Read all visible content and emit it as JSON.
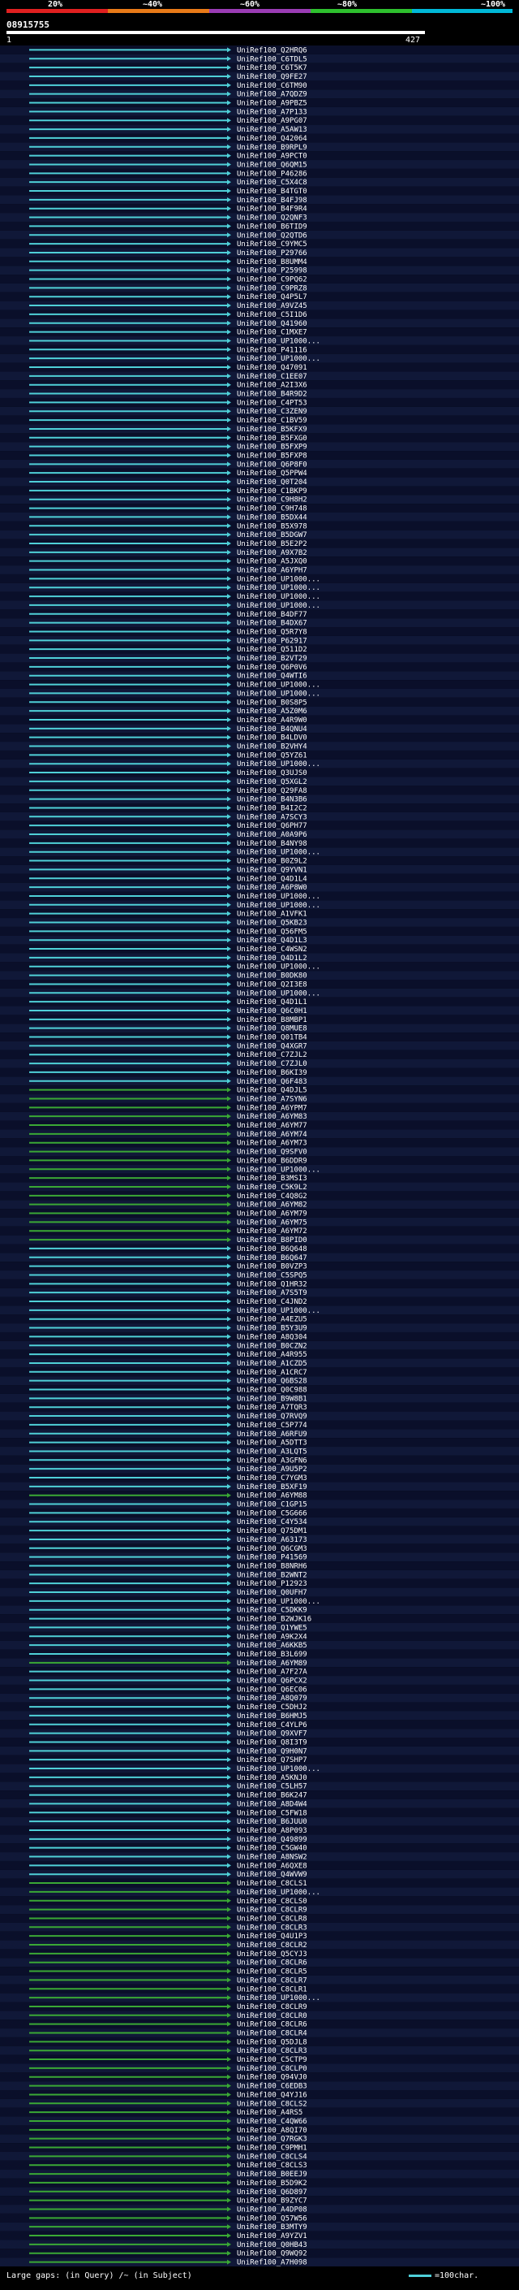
{
  "legend": {
    "percent_marks": [
      "20%",
      "~40%",
      "~60%",
      "~80%",
      "~100%"
    ],
    "band_colors": [
      "#e02020",
      "#e87a18",
      "#9a3cb4",
      "#2ec02e",
      "#00b8d8"
    ]
  },
  "query": {
    "id": "08915755",
    "length_start": "1",
    "length_end": "427"
  },
  "colors": {
    "cyan_hit": "#4fd0d8",
    "green_hit": "#3aa835",
    "row_bg_dark": "#0a0f2a",
    "row_bg_light": "#101838",
    "label": "#ffffff"
  },
  "hits": [
    {
      "label": "UniRef100_Q2HRQ6",
      "color": "cyan"
    },
    {
      "label": "UniRef100_C6TDL5",
      "color": "cyan"
    },
    {
      "label": "UniRef100_C6T5K7",
      "color": "cyan"
    },
    {
      "label": "UniRef100_Q9FE27",
      "color": "cyan"
    },
    {
      "label": "UniRef100_C6TM90",
      "color": "cyan"
    },
    {
      "label": "UniRef100_A7QDZ9",
      "color": "cyan"
    },
    {
      "label": "UniRef100_A9PBZ5",
      "color": "cyan"
    },
    {
      "label": "UniRef100_A7P133",
      "color": "cyan"
    },
    {
      "label": "UniRef100_A9PG07",
      "color": "cyan"
    },
    {
      "label": "UniRef100_A5AW13",
      "color": "cyan"
    },
    {
      "label": "UniRef100_Q42064",
      "color": "cyan"
    },
    {
      "label": "UniRef100_B9RPL9",
      "color": "cyan"
    },
    {
      "label": "UniRef100_A9PCT0",
      "color": "cyan"
    },
    {
      "label": "UniRef100_Q6QM15",
      "color": "cyan"
    },
    {
      "label": "UniRef100_P46286",
      "color": "cyan"
    },
    {
      "label": "UniRef100_C5X4C8",
      "color": "cyan"
    },
    {
      "label": "UniRef100_B4TGT0",
      "color": "cyan"
    },
    {
      "label": "UniRef100_B4FJ98",
      "color": "cyan"
    },
    {
      "label": "UniRef100_B4F9R4",
      "color": "cyan"
    },
    {
      "label": "UniRef100_Q2QNF3",
      "color": "cyan"
    },
    {
      "label": "UniRef100_B6TID9",
      "color": "cyan"
    },
    {
      "label": "UniRef100_Q2QTD6",
      "color": "cyan"
    },
    {
      "label": "UniRef100_C9YMC5",
      "color": "cyan"
    },
    {
      "label": "UniRef100_P29766",
      "color": "cyan"
    },
    {
      "label": "UniRef100_B8UMM4",
      "color": "cyan"
    },
    {
      "label": "UniRef100_P25998",
      "color": "cyan"
    },
    {
      "label": "UniRef100_C9PQ62",
      "color": "cyan"
    },
    {
      "label": "UniRef100_C9PRZ8",
      "color": "cyan"
    },
    {
      "label": "UniRef100_Q4P5L7",
      "color": "cyan"
    },
    {
      "label": "UniRef100_A9VZ45",
      "color": "cyan"
    },
    {
      "label": "UniRef100_C5I1D6",
      "color": "cyan"
    },
    {
      "label": "UniRef100_Q41960",
      "color": "cyan"
    },
    {
      "label": "UniRef100_C1MXE7",
      "color": "cyan"
    },
    {
      "label": "UniRef100_UP1000...",
      "color": "cyan"
    },
    {
      "label": "UniRef100_P41116",
      "color": "cyan"
    },
    {
      "label": "UniRef100_UP1000...",
      "color": "cyan"
    },
    {
      "label": "UniRef100_Q47091",
      "color": "cyan"
    },
    {
      "label": "UniRef100_C1EE07",
      "color": "cyan"
    },
    {
      "label": "UniRef100_A2I3X6",
      "color": "cyan"
    },
    {
      "label": "UniRef100_B4R9D2",
      "color": "cyan"
    },
    {
      "label": "UniRef100_C4PT53",
      "color": "cyan"
    },
    {
      "label": "UniRef100_C3ZEN9",
      "color": "cyan"
    },
    {
      "label": "UniRef100_C1BV59",
      "color": "cyan"
    },
    {
      "label": "UniRef100_B5KFX9",
      "color": "cyan"
    },
    {
      "label": "UniRef100_B5FXG0",
      "color": "cyan"
    },
    {
      "label": "UniRef100_B5FXP9",
      "color": "cyan"
    },
    {
      "label": "UniRef100_B5FXP8",
      "color": "cyan"
    },
    {
      "label": "UniRef100_Q6P8F0",
      "color": "cyan"
    },
    {
      "label": "UniRef100_Q5PPW4",
      "color": "cyan"
    },
    {
      "label": "UniRef100_Q0T204",
      "color": "cyan"
    },
    {
      "label": "UniRef100_C1BKP9",
      "color": "cyan"
    },
    {
      "label": "UniRef100_C9H8H2",
      "color": "cyan"
    },
    {
      "label": "UniRef100_C9H748",
      "color": "cyan"
    },
    {
      "label": "UniRef100_B5DX44",
      "color": "cyan"
    },
    {
      "label": "UniRef100_B5X978",
      "color": "cyan"
    },
    {
      "label": "UniRef100_B5DGW7",
      "color": "cyan"
    },
    {
      "label": "UniRef100_B5E2P2",
      "color": "cyan"
    },
    {
      "label": "UniRef100_A9X7B2",
      "color": "cyan"
    },
    {
      "label": "UniRef100_A5JXQ0",
      "color": "cyan"
    },
    {
      "label": "UniRef100_A6YPH7",
      "color": "cyan"
    },
    {
      "label": "UniRef100_UP1000...",
      "color": "cyan"
    },
    {
      "label": "UniRef100_UP1000...",
      "color": "cyan"
    },
    {
      "label": "UniRef100_UP1000...",
      "color": "cyan"
    },
    {
      "label": "UniRef100_UP1000...",
      "color": "cyan"
    },
    {
      "label": "UniRef100_B4DF77",
      "color": "cyan"
    },
    {
      "label": "UniRef100_B4DX67",
      "color": "cyan"
    },
    {
      "label": "UniRef100_Q5R7Y8",
      "color": "cyan"
    },
    {
      "label": "UniRef100_P62917",
      "color": "cyan"
    },
    {
      "label": "UniRef100_Q511D2",
      "color": "cyan"
    },
    {
      "label": "UniRef100_B2VT29",
      "color": "cyan"
    },
    {
      "label": "UniRef100_Q6P0V6",
      "color": "cyan"
    },
    {
      "label": "UniRef100_Q4WTI6",
      "color": "cyan"
    },
    {
      "label": "UniRef100_UP1000...",
      "color": "cyan"
    },
    {
      "label": "UniRef100_UP1000...",
      "color": "cyan"
    },
    {
      "label": "UniRef100_B0S8P5",
      "color": "cyan"
    },
    {
      "label": "UniRef100_A5Z0M6",
      "color": "cyan"
    },
    {
      "label": "UniRef100_A4R9W0",
      "color": "cyan"
    },
    {
      "label": "UniRef100_B4QNU4",
      "color": "cyan"
    },
    {
      "label": "UniRef100_B4LDV0",
      "color": "cyan"
    },
    {
      "label": "UniRef100_B2VHY4",
      "color": "cyan"
    },
    {
      "label": "UniRef100_Q5YZ61",
      "color": "cyan"
    },
    {
      "label": "UniRef100_UP1000...",
      "color": "cyan"
    },
    {
      "label": "UniRef100_Q3UJS0",
      "color": "cyan"
    },
    {
      "label": "UniRef100_Q5XGL2",
      "color": "cyan"
    },
    {
      "label": "UniRef100_Q29FA8",
      "color": "cyan"
    },
    {
      "label": "UniRef100_B4N3B6",
      "color": "cyan"
    },
    {
      "label": "UniRef100_B4I2C2",
      "color": "cyan"
    },
    {
      "label": "UniRef100_A7SCY3",
      "color": "cyan"
    },
    {
      "label": "UniRef100_Q6PH77",
      "color": "cyan"
    },
    {
      "label": "UniRef100_A0A9P6",
      "color": "cyan"
    },
    {
      "label": "UniRef100_B4NY98",
      "color": "cyan"
    },
    {
      "label": "UniRef100_UP1000...",
      "color": "cyan"
    },
    {
      "label": "UniRef100_B0Z9L2",
      "color": "cyan"
    },
    {
      "label": "UniRef100_Q9YVN1",
      "color": "cyan"
    },
    {
      "label": "UniRef100_Q4D1L4",
      "color": "cyan"
    },
    {
      "label": "UniRef100_A6P8W0",
      "color": "cyan"
    },
    {
      "label": "UniRef100_UP1000...",
      "color": "cyan"
    },
    {
      "label": "UniRef100_UP1000...",
      "color": "cyan"
    },
    {
      "label": "UniRef100_A1VFK1",
      "color": "cyan"
    },
    {
      "label": "UniRef100_Q5KB23",
      "color": "cyan"
    },
    {
      "label": "UniRef100_Q56FM5",
      "color": "cyan"
    },
    {
      "label": "UniRef100_Q4D1L3",
      "color": "cyan"
    },
    {
      "label": "UniRef100_C4WSN2",
      "color": "cyan"
    },
    {
      "label": "UniRef100_Q4D1L2",
      "color": "cyan"
    },
    {
      "label": "UniRef100_UP1000...",
      "color": "cyan"
    },
    {
      "label": "UniRef100_B0DK80",
      "color": "cyan"
    },
    {
      "label": "UniRef100_Q2I3E8",
      "color": "cyan"
    },
    {
      "label": "UniRef100_UP1000...",
      "color": "cyan"
    },
    {
      "label": "UniRef100_Q4D1L1",
      "color": "cyan"
    },
    {
      "label": "UniRef100_Q6C0H1",
      "color": "cyan"
    },
    {
      "label": "UniRef100_B8MBP1",
      "color": "cyan"
    },
    {
      "label": "UniRef100_Q8MUE8",
      "color": "cyan"
    },
    {
      "label": "UniRef100_Q01TB4",
      "color": "cyan"
    },
    {
      "label": "UniRef100_Q4XGR7",
      "color": "cyan"
    },
    {
      "label": "UniRef100_C7ZJL2",
      "color": "cyan"
    },
    {
      "label": "UniRef100_C7ZJL0",
      "color": "cyan"
    },
    {
      "label": "UniRef100_B6KI39",
      "color": "cyan"
    },
    {
      "label": "UniRef100_Q6F483",
      "color": "cyan"
    },
    {
      "label": "UniRef100_Q4DJL5",
      "color": "green"
    },
    {
      "label": "UniRef100_A7SYN6",
      "color": "green"
    },
    {
      "label": "UniRef100_A6YPM7",
      "color": "green"
    },
    {
      "label": "UniRef100_A6YM83",
      "color": "green"
    },
    {
      "label": "UniRef100_A6YM77",
      "color": "green"
    },
    {
      "label": "UniRef100_A6YM74",
      "color": "green"
    },
    {
      "label": "UniRef100_A6YM73",
      "color": "green"
    },
    {
      "label": "UniRef100_Q9SFV0",
      "color": "green"
    },
    {
      "label": "UniRef100_B6DDR9",
      "color": "green"
    },
    {
      "label": "UniRef100_UP1000...",
      "color": "green"
    },
    {
      "label": "UniRef100_B3MSI3",
      "color": "green"
    },
    {
      "label": "UniRef100_C5K9L2",
      "color": "green"
    },
    {
      "label": "UniRef100_C4Q8G2",
      "color": "green"
    },
    {
      "label": "UniRef100_A6YM82",
      "color": "green"
    },
    {
      "label": "UniRef100_A6YM79",
      "color": "green"
    },
    {
      "label": "UniRef100_A6YM75",
      "color": "green"
    },
    {
      "label": "UniRef100_A6YM72",
      "color": "green"
    },
    {
      "label": "UniRef100_B8PID0",
      "color": "green"
    },
    {
      "label": "UniRef100_B6Q648",
      "color": "cyan"
    },
    {
      "label": "UniRef100_B6Q647",
      "color": "cyan"
    },
    {
      "label": "UniRef100_B0VZP3",
      "color": "cyan"
    },
    {
      "label": "UniRef100_C5SPQ5",
      "color": "cyan"
    },
    {
      "label": "UniRef100_Q1HR32",
      "color": "cyan"
    },
    {
      "label": "UniRef100_A7S5T9",
      "color": "cyan"
    },
    {
      "label": "UniRef100_C4JND2",
      "color": "cyan"
    },
    {
      "label": "UniRef100_UP1000...",
      "color": "cyan"
    },
    {
      "label": "UniRef100_A4EZU5",
      "color": "cyan"
    },
    {
      "label": "UniRef100_B5Y3U9",
      "color": "cyan"
    },
    {
      "label": "UniRef100_A8Q304",
      "color": "cyan"
    },
    {
      "label": "UniRef100_B0CZN2",
      "color": "cyan"
    },
    {
      "label": "UniRef100_A4R955",
      "color": "cyan"
    },
    {
      "label": "UniRef100_A1CZD5",
      "color": "cyan"
    },
    {
      "label": "UniRef100_A1CRC7",
      "color": "cyan"
    },
    {
      "label": "UniRef100_Q6BS28",
      "color": "cyan"
    },
    {
      "label": "UniRef100_Q0C988",
      "color": "cyan"
    },
    {
      "label": "UniRef100_B9W8B1",
      "color": "cyan"
    },
    {
      "label": "UniRef100_A7TQR3",
      "color": "cyan"
    },
    {
      "label": "UniRef100_Q7RVQ9",
      "color": "cyan"
    },
    {
      "label": "UniRef100_C5P774",
      "color": "cyan"
    },
    {
      "label": "UniRef100_A6RFU9",
      "color": "cyan"
    },
    {
      "label": "UniRef100_A5DTT3",
      "color": "cyan"
    },
    {
      "label": "UniRef100_A3LQT5",
      "color": "cyan"
    },
    {
      "label": "UniRef100_A3GFN6",
      "color": "cyan"
    },
    {
      "label": "UniRef100_A9U5P2",
      "color": "cyan"
    },
    {
      "label": "UniRef100_C7YGM3",
      "color": "cyan"
    },
    {
      "label": "UniRef100_B5XF19",
      "color": "cyan"
    },
    {
      "label": "UniRef100_A6YM88",
      "color": "green"
    },
    {
      "label": "UniRef100_C1GP15",
      "color": "cyan"
    },
    {
      "label": "UniRef100_C5G666",
      "color": "cyan"
    },
    {
      "label": "UniRef100_C4Y534",
      "color": "cyan"
    },
    {
      "label": "UniRef100_Q75DM1",
      "color": "cyan"
    },
    {
      "label": "UniRef100_A63173",
      "color": "cyan"
    },
    {
      "label": "UniRef100_Q6CGM3",
      "color": "cyan"
    },
    {
      "label": "UniRef100_P41569",
      "color": "cyan"
    },
    {
      "label": "UniRef100_B8NRH6",
      "color": "cyan"
    },
    {
      "label": "UniRef100_B2WNT2",
      "color": "cyan"
    },
    {
      "label": "UniRef100_P12923",
      "color": "cyan"
    },
    {
      "label": "UniRef100_Q0UFH7",
      "color": "cyan"
    },
    {
      "label": "UniRef100_UP1000...",
      "color": "cyan"
    },
    {
      "label": "UniRef100_C5DKK9",
      "color": "cyan"
    },
    {
      "label": "UniRef100_B2WJK16",
      "color": "cyan"
    },
    {
      "label": "UniRef100_Q1YWE5",
      "color": "cyan"
    },
    {
      "label": "UniRef100_A9K2X4",
      "color": "cyan"
    },
    {
      "label": "UniRef100_A6KKB5",
      "color": "cyan"
    },
    {
      "label": "UniRef100_B3L699",
      "color": "cyan"
    },
    {
      "label": "UniRef100_A6YM89",
      "color": "green"
    },
    {
      "label": "UniRef100_A7F27A",
      "color": "cyan"
    },
    {
      "label": "UniRef100_Q6PCX2",
      "color": "cyan"
    },
    {
      "label": "UniRef100_Q6EC06",
      "color": "cyan"
    },
    {
      "label": "UniRef100_A8Q079",
      "color": "cyan"
    },
    {
      "label": "UniRef100_C5DHJ2",
      "color": "cyan"
    },
    {
      "label": "UniRef100_B6HMJ5",
      "color": "cyan"
    },
    {
      "label": "UniRef100_C4YLP6",
      "color": "cyan"
    },
    {
      "label": "UniRef100_Q9XVF7",
      "color": "cyan"
    },
    {
      "label": "UniRef100_Q8I3T9",
      "color": "cyan"
    },
    {
      "label": "UniRef100_Q9H0N7",
      "color": "cyan"
    },
    {
      "label": "UniRef100_Q7SHP7",
      "color": "cyan"
    },
    {
      "label": "UniRef100_UP1000...",
      "color": "cyan"
    },
    {
      "label": "UniRef100_A5KNJ0",
      "color": "cyan"
    },
    {
      "label": "UniRef100_C5LH57",
      "color": "cyan"
    },
    {
      "label": "UniRef100_B6K247",
      "color": "cyan"
    },
    {
      "label": "UniRef100_A8D4W4",
      "color": "cyan"
    },
    {
      "label": "UniRef100_C5FW18",
      "color": "cyan"
    },
    {
      "label": "UniRef100_B6JUU0",
      "color": "cyan"
    },
    {
      "label": "UniRef100_A8P093",
      "color": "cyan"
    },
    {
      "label": "UniRef100_Q49899",
      "color": "cyan"
    },
    {
      "label": "UniRef100_C5GW40",
      "color": "cyan"
    },
    {
      "label": "UniRef100_A8NSW2",
      "color": "cyan"
    },
    {
      "label": "UniRef100_A6QXE8",
      "color": "cyan"
    },
    {
      "label": "UniRef100_Q4WVW9",
      "color": "cyan"
    },
    {
      "label": "UniRef100_C8CLS1",
      "color": "green"
    },
    {
      "label": "UniRef100_UP1000...",
      "color": "green"
    },
    {
      "label": "UniRef100_C8CLS0",
      "color": "green"
    },
    {
      "label": "UniRef100_C8CLR9",
      "color": "green"
    },
    {
      "label": "UniRef100_C8CLR8",
      "color": "green"
    },
    {
      "label": "UniRef100_C8CLR3",
      "color": "green"
    },
    {
      "label": "UniRef100_Q4U1P3",
      "color": "green"
    },
    {
      "label": "UniRef100_C8CLR2",
      "color": "green"
    },
    {
      "label": "UniRef100_Q5CYJ3",
      "color": "green"
    },
    {
      "label": "UniRef100_C8CLR6",
      "color": "green"
    },
    {
      "label": "UniRef100_C8CLR5",
      "color": "green"
    },
    {
      "label": "UniRef100_C8CLR7",
      "color": "green"
    },
    {
      "label": "UniRef100_C8CLR1",
      "color": "green"
    },
    {
      "label": "UniRef100_UP1000...",
      "color": "green"
    },
    {
      "label": "UniRef100_C8CLR9",
      "color": "green"
    },
    {
      "label": "UniRef100_C8CLR0",
      "color": "green"
    },
    {
      "label": "UniRef100_C8CLR6",
      "color": "green"
    },
    {
      "label": "UniRef100_C8CLR4",
      "color": "green"
    },
    {
      "label": "UniRef100_Q5DJL8",
      "color": "green"
    },
    {
      "label": "UniRef100_C8CLR3",
      "color": "green"
    },
    {
      "label": "UniRef100_C5CTP9",
      "color": "green"
    },
    {
      "label": "UniRef100_C8CLP0",
      "color": "green"
    },
    {
      "label": "UniRef100_Q94VJ0",
      "color": "green"
    },
    {
      "label": "UniRef100_C6EDB3",
      "color": "green"
    },
    {
      "label": "UniRef100_Q4YJ16",
      "color": "green"
    },
    {
      "label": "UniRef100_C8CLS2",
      "color": "green"
    },
    {
      "label": "UniRef100_A4RS5",
      "color": "green"
    },
    {
      "label": "UniRef100_C4QW66",
      "color": "green"
    },
    {
      "label": "UniRef100_A8QI70",
      "color": "green"
    },
    {
      "label": "UniRef100_Q7RGK3",
      "color": "green"
    },
    {
      "label": "UniRef100_C9PMH1",
      "color": "green"
    },
    {
      "label": "UniRef100_C8CLS4",
      "color": "green"
    },
    {
      "label": "UniRef100_C8CLS3",
      "color": "green"
    },
    {
      "label": "UniRef100_B0EEJ9",
      "color": "green"
    },
    {
      "label": "UniRef100_B5D9K2",
      "color": "green"
    },
    {
      "label": "UniRef100_Q6D897",
      "color": "green"
    },
    {
      "label": "UniRef100_B9ZYC7",
      "color": "green"
    },
    {
      "label": "UniRef100_A4DP08",
      "color": "green"
    },
    {
      "label": "UniRef100_Q57W56",
      "color": "green"
    },
    {
      "label": "UniRef100_B3MTY9",
      "color": "green"
    },
    {
      "label": "UniRef100_A9YZV1",
      "color": "green"
    },
    {
      "label": "UniRef100_Q0HB43",
      "color": "green"
    },
    {
      "label": "UniRef100_Q9WQ92",
      "color": "green"
    },
    {
      "label": "UniRef100_A7H098",
      "color": "green"
    }
  ],
  "footer": {
    "large_gaps_label": "Large gaps:",
    "in_query_text": "(in Query)",
    "in_subject_text": "/~ (in Subject)",
    "scale_key_text": "=100char."
  }
}
